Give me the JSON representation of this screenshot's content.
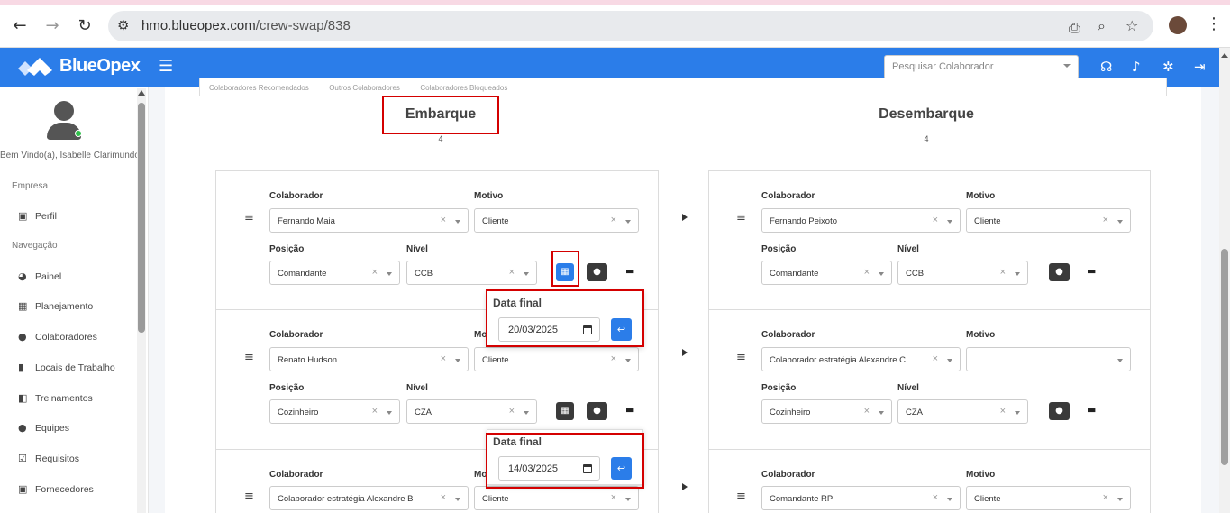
{
  "browser": {
    "url_host": "hmo.blueopex.com",
    "url_path": "/crew-swap/838"
  },
  "header": {
    "brand": "BlueOpex",
    "search_placeholder": "Pesquisar Colaborador",
    "brand_color": "#2b7de9"
  },
  "sidebar": {
    "welcome": "Bem Vindo(a), Isabelle Clarimundo",
    "section_company": "Empresa",
    "section_nav": "Navegação",
    "items": [
      {
        "label": "Perfil",
        "icon": "briefcase-icon"
      },
      {
        "label": "Painel",
        "icon": "dashboard-icon"
      },
      {
        "label": "Planejamento",
        "icon": "calendar-icon"
      },
      {
        "label": "Colaboradores",
        "icon": "users-icon"
      },
      {
        "label": "Locais de Trabalho",
        "icon": "building-icon"
      },
      {
        "label": "Treinamentos",
        "icon": "training-icon"
      },
      {
        "label": "Equipes",
        "icon": "team-icon"
      },
      {
        "label": "Requisitos",
        "icon": "checkbox-icon"
      },
      {
        "label": "Fornecedores",
        "icon": "briefcase-icon"
      }
    ]
  },
  "tabs": [
    "Colaboradores Recomendados",
    "Outros Colaboradores",
    "Colaboradores Bloqueados"
  ],
  "embarque": {
    "title": "Embarque",
    "count": "4",
    "rows": [
      {
        "colaborador": "Fernando Maia",
        "motivo": "Cliente",
        "posicao": "Comandante",
        "nivel": "CCB"
      },
      {
        "colaborador": "Renato Hudson",
        "motivo": "Cliente",
        "posicao": "Cozinheiro",
        "nivel": "CZA"
      },
      {
        "colaborador": "Colaborador estratégia Alexandre B",
        "motivo": "Cliente"
      }
    ]
  },
  "desembarque": {
    "title": "Desembarque",
    "count": "4",
    "rows": [
      {
        "colaborador": "Fernando Peixoto",
        "motivo": "Cliente",
        "posicao": "Comandante",
        "nivel": "CCB"
      },
      {
        "colaborador": "Colaborador estratégia Alexandre C",
        "motivo": "",
        "posicao": "Cozinheiro",
        "nivel": "CZA"
      },
      {
        "colaborador": "Comandante RP",
        "motivo": "Cliente"
      }
    ]
  },
  "labels": {
    "colaborador": "Colaborador",
    "motivo": "Motivo",
    "motivo_partial": "Mo",
    "posicao": "Posição",
    "nivel": "Nível",
    "clear": "×"
  },
  "popups": [
    {
      "title": "Data final",
      "date": "20/03/2025"
    },
    {
      "title": "Data final",
      "date": "14/03/2025"
    }
  ]
}
